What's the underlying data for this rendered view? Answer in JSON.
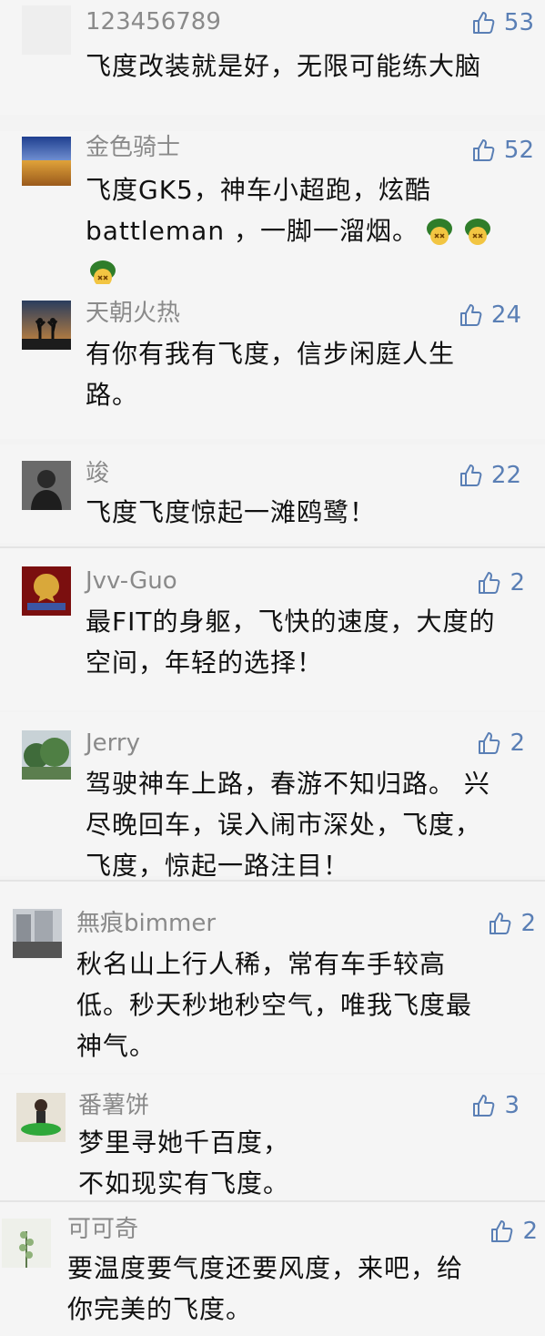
{
  "comments": [
    {
      "name": "123456789",
      "likes": "53",
      "lines": [
        "飞度改装就是好，无限可能练大脑"
      ]
    },
    {
      "name": "金色骑士",
      "likes": "52",
      "lines": [
        "飞度GK5，神车小超跑，炫酷",
        "battleman ，一脚一溜烟。"
      ]
    },
    {
      "name": "天朝火热",
      "likes": "24",
      "lines": [
        "有你有我有飞度，信步闲庭人生",
        "路。"
      ]
    },
    {
      "name": "竣",
      "likes": "22",
      "lines": [
        "飞度飞度惊起一滩鸥鹭！"
      ]
    },
    {
      "name": "Jvv-Guo",
      "likes": "2",
      "lines": [
        "最FIT的身躯，飞快的速度，大度的",
        "空间，年轻的选择！"
      ]
    },
    {
      "name": "Jerry",
      "likes": "2",
      "lines": [
        "驾驶神车上路，春游不知归路。 兴",
        "尽晚回车，误入闹市深处，飞度，",
        "飞度，惊起一路注目！"
      ]
    },
    {
      "name": "無痕bimmer",
      "likes": "2",
      "lines": [
        "秋名山上行人稀，常有车手较高",
        "低。秒天秒地秒空气，唯我飞度最",
        "神气。"
      ]
    },
    {
      "name": "番薯饼",
      "likes": "3",
      "lines": [
        "梦里寻她千百度，",
        "不如现实有飞度。"
      ]
    },
    {
      "name": "可可奇",
      "likes": "2",
      "lines": [
        "要温度要气度还要风度，来吧，给",
        "你完美的飞度。"
      ]
    }
  ],
  "icons": {
    "like": "thumbs-up-icon",
    "emoji": "dizzy-face-turtle-icon"
  },
  "colors": {
    "like": "#5a7fb5",
    "name": "#8a8a8a",
    "text": "#111111",
    "background": "#f5f5f5"
  }
}
